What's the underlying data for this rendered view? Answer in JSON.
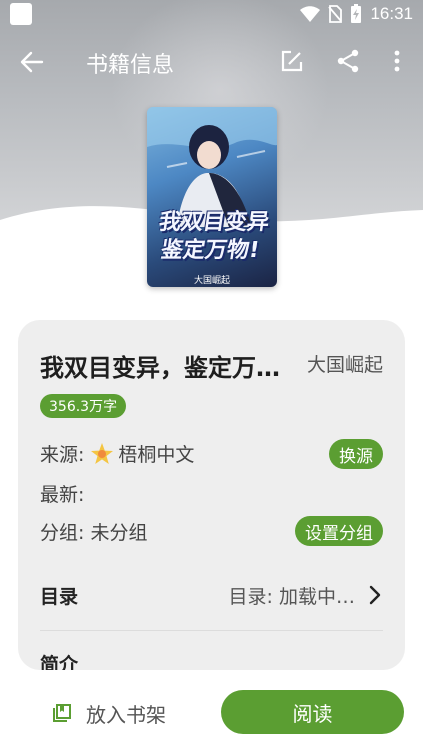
{
  "status_bar": {
    "time": "16:31"
  },
  "toolbar": {
    "title": "书籍信息",
    "back_icon": "arrow-back-icon",
    "edit_icon": "edit-icon",
    "share_icon": "share-icon",
    "more_icon": "more-vert-icon"
  },
  "cover": {
    "title_line1": "我双目变异",
    "title_line2": "鉴定万物!",
    "author": "大国崛起"
  },
  "book": {
    "name": "我双目变异，鉴定万…",
    "author": "大国崛起",
    "word_count": "356.3万字",
    "source_label": "来源:",
    "source_name": "梧桐中文",
    "change_source_button": "换源",
    "latest_label": "最新:",
    "group_label": "分组: 未分组",
    "set_group_button": "设置分组",
    "catalog_label": "目录",
    "catalog_status": "目录: 加载中…",
    "intro_label": "简介"
  },
  "bottom": {
    "add_to_shelf": "放入书架",
    "read": "阅读"
  },
  "colors": {
    "accent": "#5b9e32",
    "card_bg": "#eeeeee"
  }
}
